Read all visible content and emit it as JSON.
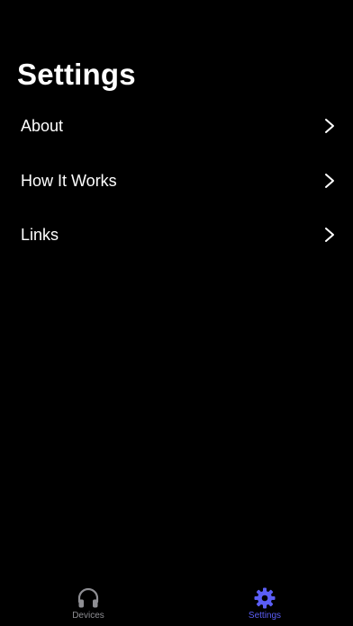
{
  "header": {
    "title": "Settings"
  },
  "menu": {
    "items": [
      {
        "label": "About"
      },
      {
        "label": "How It Works"
      },
      {
        "label": "Links"
      }
    ]
  },
  "tab_bar": {
    "tabs": [
      {
        "label": "Devices",
        "icon": "headphones-icon",
        "active": false
      },
      {
        "label": "Settings",
        "icon": "gear-icon",
        "active": true
      }
    ]
  },
  "colors": {
    "background": "#000000",
    "text": "#ffffff",
    "chevron": "#ffffff",
    "tab_active": "#5b5ef6",
    "tab_inactive": "#8e8e93"
  }
}
